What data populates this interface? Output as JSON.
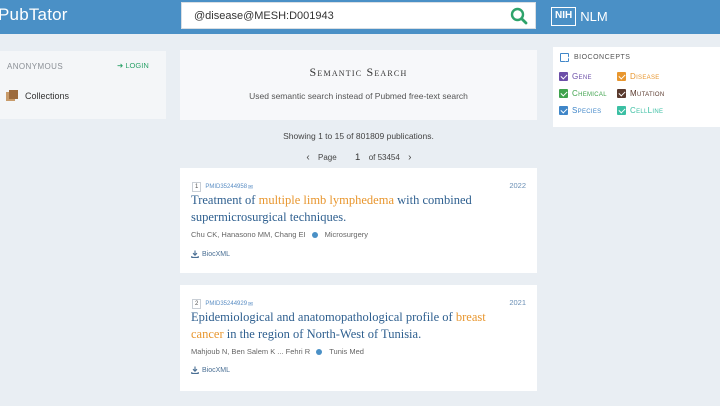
{
  "header": {
    "brand": "PubTator",
    "search_value": "@disease@MESH:D001943",
    "nih_label": "NIH",
    "nlm_label": "NLM"
  },
  "sidebar": {
    "user_label": "ANONYMOUS",
    "login_label": "LOGIN",
    "collections_label": "Collections"
  },
  "semantic": {
    "title": "Semantic Search",
    "subtitle": "Used semantic search instead of Pubmed free-text search"
  },
  "results_info": {
    "showing": "Showing 1 to 15 of 801809 publications.",
    "page_label": "Page",
    "page_number": "1",
    "of_label": "of 53454"
  },
  "results": [
    {
      "num": "1",
      "pmid": "PMID35244958",
      "year": "2022",
      "title_parts": {
        "a": "Treatment of ",
        "b": "multiple limb lymphedema",
        "c": " with combined supermicrosurgical techniques."
      },
      "authors": "Chu CK, Hanasono MM, Chang EI",
      "journal": "Microsurgery",
      "bioc_label": "BiocXML"
    },
    {
      "num": "2",
      "pmid": "PMID35244929",
      "year": "2021",
      "title_parts": {
        "a": "Epidemiological and anatomopathological profile of ",
        "b": "breast cancer",
        "c": " in the region of North-West of Tunisia."
      },
      "authors": "Mahjoub N, Ben Salem K ... Fehri R",
      "journal": "Tunis Med",
      "bioc_label": "BiocXML"
    }
  ],
  "bioconcepts": {
    "heading": "BIOCONCEPTS",
    "items": [
      {
        "label": "Gene",
        "color": "#6c4fa8"
      },
      {
        "label": "Disease",
        "color": "#e8962e"
      },
      {
        "label": "Chemical",
        "color": "#3fa34d"
      },
      {
        "label": "Mutation",
        "color": "#5a3a2e"
      },
      {
        "label": "Species",
        "color": "#3f86c8"
      },
      {
        "label": "CellLine",
        "color": "#3bbfa3"
      }
    ]
  },
  "colors": {
    "accent": "#4a90c6",
    "highlight": "#e8962e",
    "title_link": "#2e5f8f",
    "login": "#2ea36b"
  }
}
